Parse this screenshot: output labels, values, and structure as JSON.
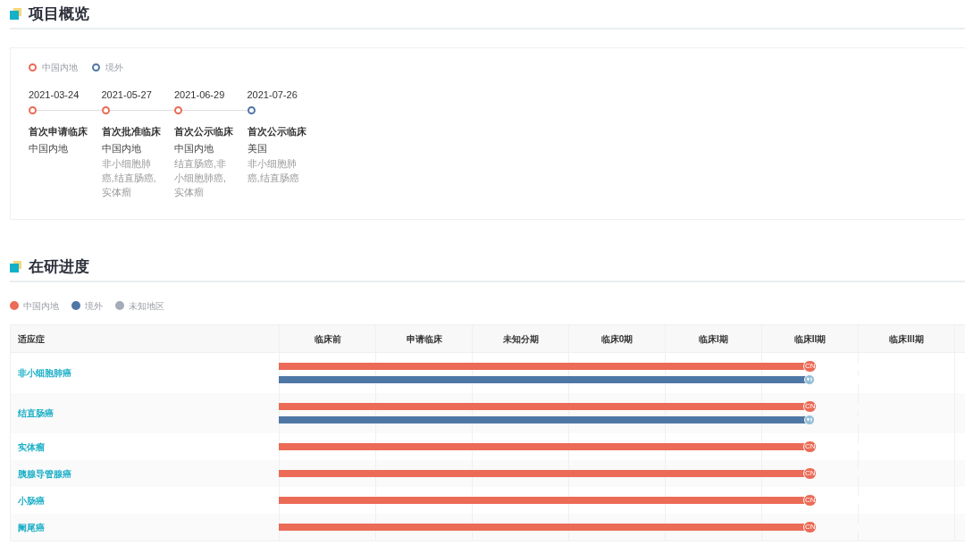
{
  "overview": {
    "title": "项目概览",
    "legend": [
      {
        "label": "中国内地",
        "color": "#eb6b56"
      },
      {
        "label": "境外",
        "color": "#4f77a5"
      }
    ],
    "events": [
      {
        "date": "2021-03-24",
        "color": "#eb6b56",
        "title": "首次申请临床",
        "region": "中国内地"
      },
      {
        "date": "2021-05-27",
        "color": "#eb6b56",
        "title": "首次批准临床",
        "region": "中国内地",
        "detail": "非小细胞肺癌,结直肠癌,实体瘤"
      },
      {
        "date": "2021-06-29",
        "color": "#eb6b56",
        "title": "首次公示临床",
        "region": "中国内地",
        "detail": "结直肠癌,非小细胞肺癌,实体瘤"
      },
      {
        "date": "2021-07-26",
        "color": "#4f77a5",
        "title": "首次公示临床",
        "region": "美国",
        "detail": "非小细胞肺癌,结直肠癌"
      }
    ]
  },
  "progress": {
    "title": "在研进度",
    "legend": [
      {
        "label": "中国内地",
        "color": "#eb6b56"
      },
      {
        "label": "境外",
        "color": "#4f77a5"
      },
      {
        "label": "未知地区",
        "color": "#a5abb7"
      }
    ],
    "table": {
      "columns": [
        "适应症",
        "临床前",
        "申请临床",
        "未知分期",
        "临床0期",
        "临床I期",
        "临床II期",
        "临床III期"
      ],
      "rows": [
        {
          "name": "非小细胞肺癌",
          "bars": [
            {
              "kind": "cn",
              "color": "#eb6b56",
              "level": 0.786,
              "badge": "CN"
            },
            {
              "kind": "overseas",
              "color": "#4f77a5",
              "level": 0.786
            }
          ]
        },
        {
          "name": "结直肠癌",
          "bars": [
            {
              "kind": "cn",
              "color": "#eb6b56",
              "level": 0.786,
              "badge": "CN"
            },
            {
              "kind": "overseas",
              "color": "#4f77a5",
              "level": 0.786
            }
          ]
        },
        {
          "name": "实体瘤",
          "bars": [
            {
              "kind": "cn",
              "color": "#eb6b56",
              "level": 0.786,
              "badge": "CN"
            }
          ]
        },
        {
          "name": "胰腺导管腺癌",
          "bars": [
            {
              "kind": "cn",
              "color": "#eb6b56",
              "level": 0.786,
              "badge": "CN"
            }
          ]
        },
        {
          "name": "小肠癌",
          "bars": [
            {
              "kind": "cn",
              "color": "#eb6b56",
              "level": 0.786,
              "badge": "CN"
            }
          ]
        },
        {
          "name": "阑尾癌",
          "bars": [
            {
              "kind": "cn",
              "color": "#eb6b56",
              "level": 0.786,
              "badge": "CN"
            }
          ]
        }
      ]
    }
  }
}
